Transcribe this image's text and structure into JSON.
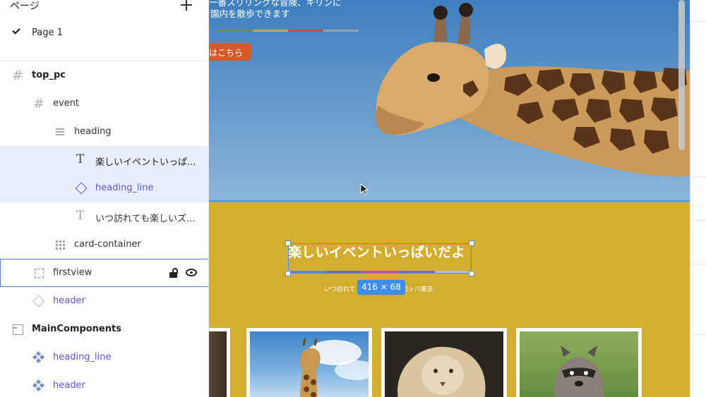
{
  "layers_panel": {
    "pages_label": "ページ",
    "current_page": "Page 1",
    "layers": [
      {
        "label": "top_pc"
      },
      {
        "label": "event"
      },
      {
        "label": "heading"
      },
      {
        "label": "楽しいイベントいっぱ..."
      },
      {
        "label": "heading_line"
      },
      {
        "label": "いつ訪れても楽しいズ..."
      },
      {
        "label": "card-container"
      },
      {
        "label": "firstview"
      },
      {
        "label": "header"
      },
      {
        "label": "MainComponents"
      },
      {
        "label": "heading_line"
      },
      {
        "label": "header"
      }
    ]
  },
  "canvas": {
    "hero": {
      "text_line1": "一番スリリングな冒険、キリンに",
      "text_line2": "園内を散歩できます",
      "button_label": "はこちら"
    },
    "event": {
      "title": "楽しいイベントいっぱいだよ",
      "subtitle_left": "いつ訪れて",
      "subtitle_right": "ロッパ東京",
      "size_badge": "416 × 68"
    },
    "cards": [
      "card-giraffe",
      "card-lion",
      "card-raccoon"
    ]
  },
  "colors": {
    "hero_sky": "#5f97c9",
    "event_bg": "#d2ae2f",
    "accent_button": "#d45a2c",
    "selection": "#4f8fe8",
    "component_purple": "#6b4fd8",
    "heading_line": [
      "#5a8ad6",
      "#7a6a9a",
      "#d0508a",
      "#8a5ad0",
      "#b8b8c8"
    ]
  }
}
